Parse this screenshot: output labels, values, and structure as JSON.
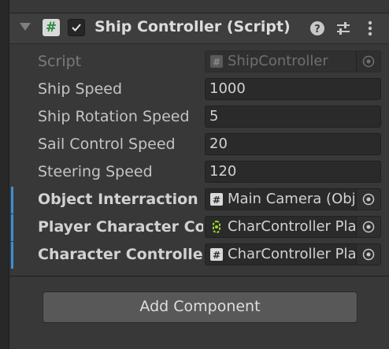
{
  "component": {
    "title": "Ship Controller (Script)",
    "enabled": true
  },
  "fields": [
    {
      "label": "Script",
      "value": "ShipController"
    },
    {
      "label": "Ship Speed",
      "value": "1000"
    },
    {
      "label": "Ship Rotation Speed",
      "value": "5"
    },
    {
      "label": "Sail Control Speed",
      "value": "20"
    },
    {
      "label": "Steering Speed",
      "value": "120"
    },
    {
      "label": "Object Interraction Controller",
      "value": "Main Camera (Object Interraction Controller)"
    },
    {
      "label": "Player Character Controller",
      "value": "CharController Player"
    },
    {
      "label": "Character Controller",
      "value": "CharController Player"
    }
  ],
  "add_component_label": "Add Component",
  "icons": {
    "script": "script-icon",
    "checkbox": "checkmark-icon",
    "help": "help-icon",
    "preset": "preset-sliders-icon",
    "menu": "kebab-menu-icon",
    "object_picker": "object-picker-icon"
  },
  "colors": {
    "background": "#383838",
    "override_marker": "#3b8fd6",
    "script_icon_green": "#2b8a3e",
    "character_icon_green": "#9fd92a"
  }
}
